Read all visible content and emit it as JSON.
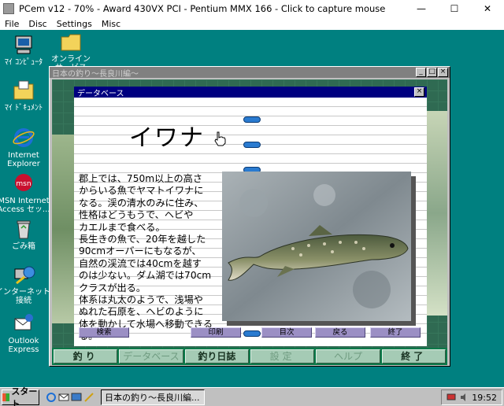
{
  "host": {
    "title": "PCem v12 - 70% - Award 430VX PCI - Pentium MMX 166 - Click to capture mouse",
    "menu": [
      "File",
      "Disc",
      "Settings",
      "Misc"
    ],
    "controls": [
      "—",
      "☐",
      "✕"
    ]
  },
  "desktop": {
    "icons": [
      {
        "label": "ﾏｲ ｺﾝﾋﾟｭｰﾀ"
      },
      {
        "label": "オンライン\nサービス"
      },
      {
        "label": "ﾏｲ ﾄﾞｷｭﾒﾝﾄ"
      },
      {
        "label": "Internet\nExplorer"
      },
      {
        "label": "MSN Internet\nAccess セッ..."
      },
      {
        "label": "ごみ箱"
      },
      {
        "label": "インターネットに\n接続"
      },
      {
        "label": "Outlook\nExpress"
      }
    ]
  },
  "game_window": {
    "title": "日本の釣り〜長良川編〜",
    "buttons": [
      "_",
      "□",
      "×"
    ]
  },
  "database": {
    "title": "データベース",
    "close": "×",
    "fish_name": "イワナ",
    "description": "郡上では、750m以上の高さ\nからいる魚でヤマトイワナに\nなる。渓の清水のみに住み、\n性格はどうもうで、ヘビや\nカエルまで食べる。\n長生きの魚で、20年を越した\n90cmオーバーにもなるが、\n自然の渓流では40cmを越す\nのは少ない。ダム湖では70cm\nクラスが出る。\n体系は丸太のようで、浅場や\nぬれた石原を、ヘビのように\n体を動かして水場へ移動できる\nる。",
    "buttons": {
      "search": "検索",
      "print": "印刷",
      "contents": "目次",
      "back": "戻る",
      "exit": "終了"
    }
  },
  "bottom_menu": {
    "fishing": "釣り",
    "database": "データベース",
    "diary": "釣り日誌",
    "settings": "設定",
    "help": "ヘルプ",
    "quit": "終了"
  },
  "taskbar": {
    "start": "スタート",
    "task": "日本の釣り〜長良川編...",
    "clock": "19:52"
  },
  "colors": {
    "desktop": "#008080",
    "active_title": "#000080",
    "ring": "#2a7bd0",
    "db_button": "#9b8fc4",
    "menu_button": "#a5cbb5"
  }
}
